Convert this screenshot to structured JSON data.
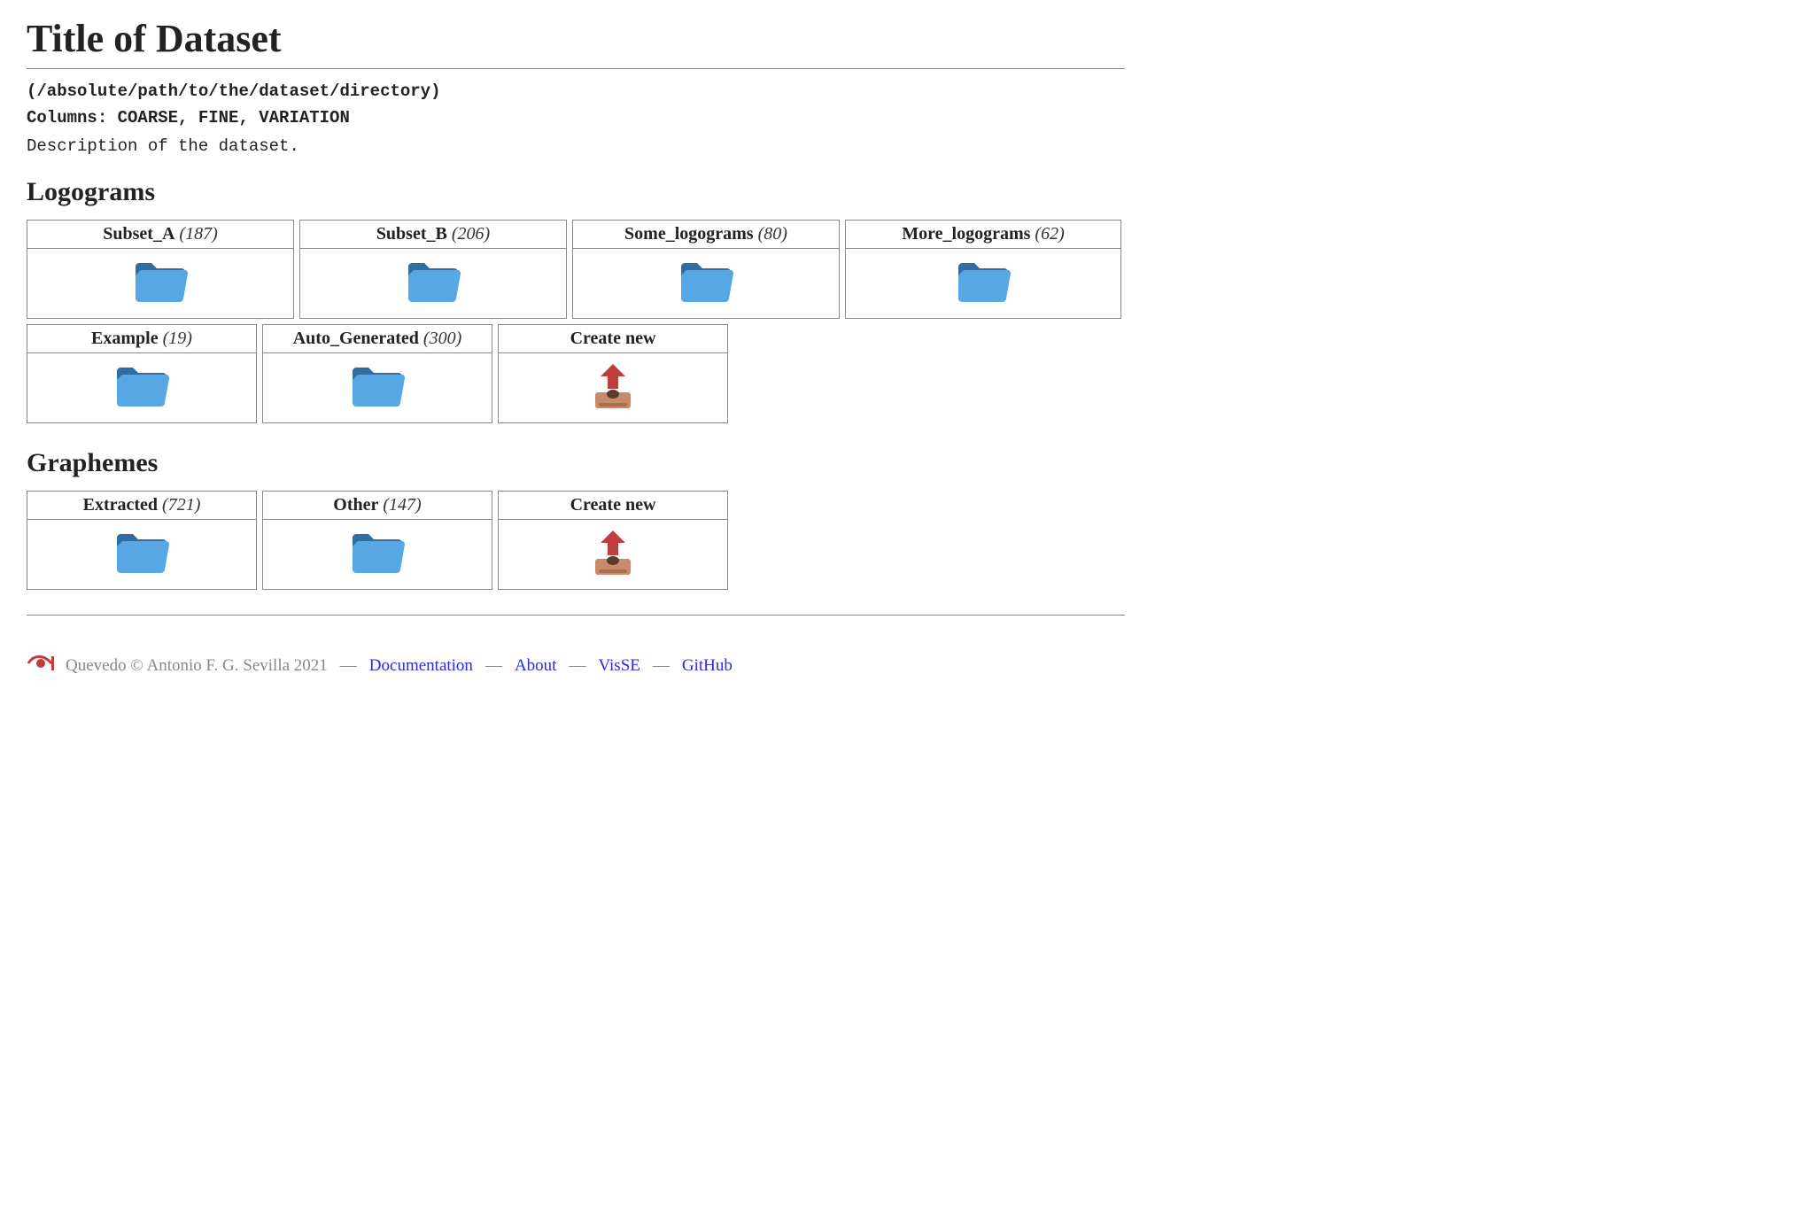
{
  "title": "Title of Dataset",
  "path_line": "(/absolute/path/to/the/dataset/directory)",
  "columns_line": "Columns: COARSE, FINE, VARIATION",
  "description": "Description of the dataset.",
  "create_new_label": "Create new",
  "sections": [
    {
      "heading": "Logograms",
      "cards": [
        {
          "name": "Subset_A",
          "count": 187
        },
        {
          "name": "Subset_B",
          "count": 206
        },
        {
          "name": "Some_logograms",
          "count": 80
        },
        {
          "name": "More_logograms",
          "count": 62
        },
        {
          "name": "Example",
          "count": 19
        },
        {
          "name": "Auto_Generated",
          "count": 300
        }
      ]
    },
    {
      "heading": "Graphemes",
      "cards": [
        {
          "name": "Extracted",
          "count": 721
        },
        {
          "name": "Other",
          "count": 147
        }
      ]
    }
  ],
  "footer": {
    "copyright": "Quevedo © Antonio F. G. Sevilla 2021",
    "links": [
      "Documentation",
      "About",
      "VisSE",
      "GitHub"
    ]
  }
}
